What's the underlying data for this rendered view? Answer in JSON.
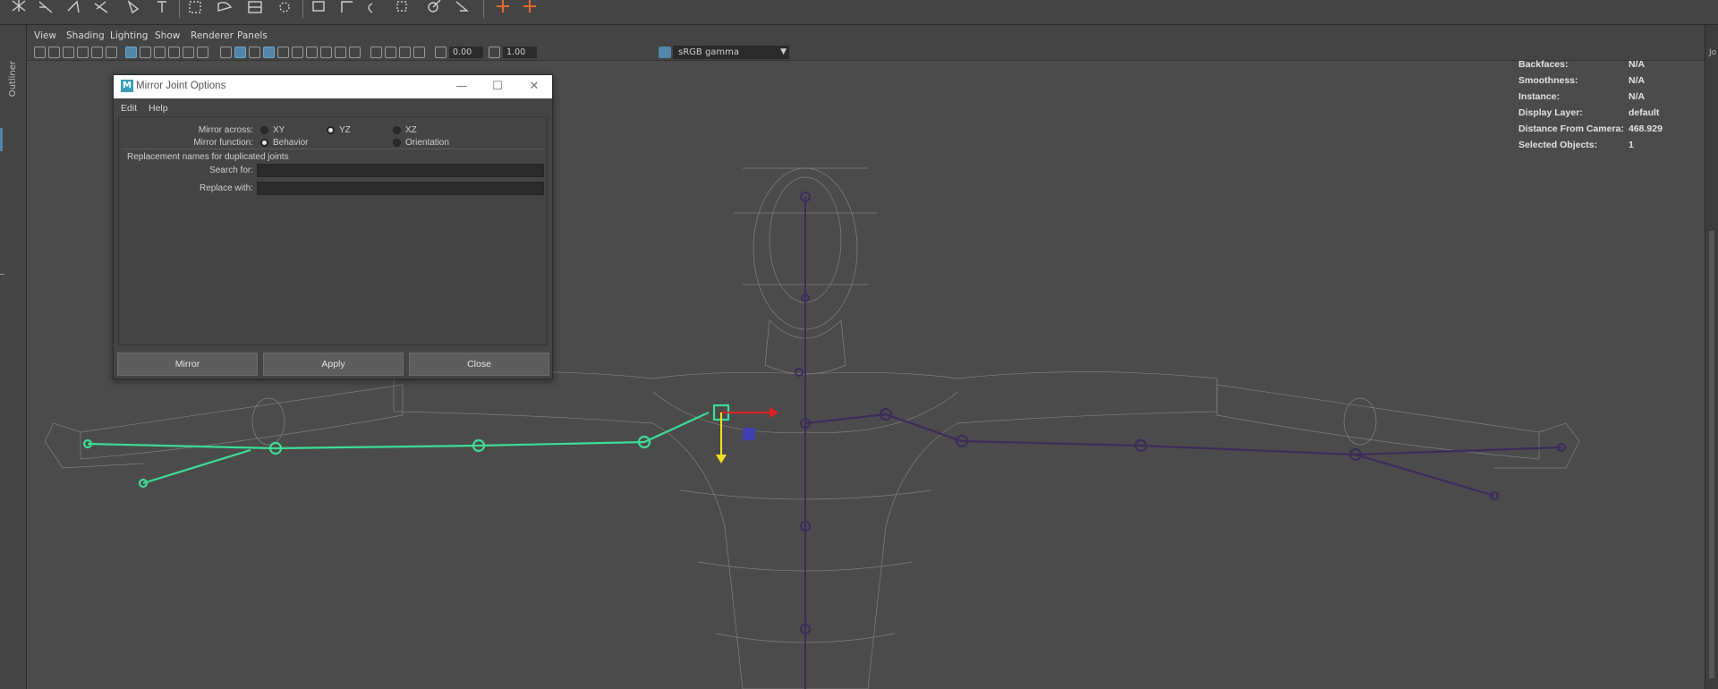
{
  "panel_menu": {
    "items": [
      "View",
      "Shading",
      "Lighting",
      "Show",
      "Renderer",
      "Panels"
    ]
  },
  "toolbar": {
    "exposure": "0.00",
    "gamma": "1.00",
    "color_space": "sRGB gamma"
  },
  "outliner": {
    "label": "Outliner"
  },
  "hud": {
    "rows": [
      {
        "label": "Backfaces:",
        "value": "N/A"
      },
      {
        "label": "Smoothness:",
        "value": "N/A"
      },
      {
        "label": "Instance:",
        "value": "N/A"
      },
      {
        "label": "Display Layer:",
        "value": "default"
      },
      {
        "label": "Distance From Camera:",
        "value": "468.929"
      },
      {
        "label": "Selected Objects:",
        "value": "1"
      }
    ]
  },
  "right_strip": {
    "text": "Jo"
  },
  "dialog": {
    "logo": "M",
    "title": "Mirror Joint Options",
    "menu": [
      "Edit",
      "Help"
    ],
    "mirror_across_label": "Mirror across:",
    "mirror_across_options": [
      "XY",
      "YZ",
      "XZ"
    ],
    "mirror_across_selected": "YZ",
    "mirror_function_label": "Mirror function:",
    "mirror_function_options": [
      "Behavior",
      "Orientation"
    ],
    "mirror_function_selected": "Behavior",
    "section_title": "Replacement names for duplicated joints",
    "search_label": "Search for:",
    "search_value": "",
    "replace_label": "Replace with:",
    "replace_value": "",
    "buttons": {
      "mirror": "Mirror",
      "apply": "Apply",
      "close": "Close"
    }
  },
  "colors": {
    "selected_joints": "#3ddc97",
    "joints": "#3c2c5a",
    "wireframe": "#8a8a8a",
    "x_axis": "#e02020",
    "y_axis": "#f0e020",
    "accent": "#5285a6"
  }
}
